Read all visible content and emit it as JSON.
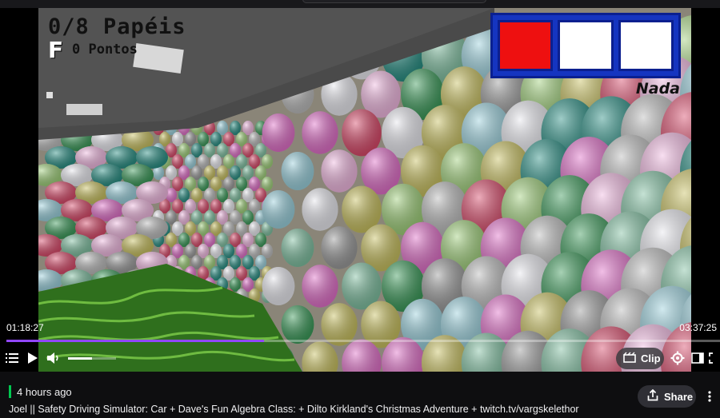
{
  "game": {
    "papers": "0/8 Papéis",
    "grade": "F",
    "points": "0 Pontos",
    "item_label": "Nada",
    "inventory_slots": [
      "selected",
      "empty",
      "empty"
    ]
  },
  "player": {
    "current_time": "01:18:27",
    "duration": "03:37:25",
    "progress_fraction": 0.361,
    "volume_fraction": 0.5,
    "clip_label": "Clip",
    "accent_color": "#9147ff"
  },
  "video_meta": {
    "age": "4 hours ago",
    "share_label": "Share",
    "title": "Joel || Safety Driving Simulator: Car + Dave's Fun Algebra Class: + Dilto Kirkland's Christmas Adventure + twitch.tv/vargskelethor",
    "live_indicator_color": "#00c850"
  },
  "icons": {
    "playlist": "list-icon",
    "play": "play-icon",
    "volume": "volume-icon",
    "clip": "clip-icon",
    "settings": "gear-icon",
    "theatre": "theatre-mode-icon",
    "fullscreen": "fullscreen-icon",
    "share": "share-icon",
    "more": "more-vertical-icon"
  }
}
